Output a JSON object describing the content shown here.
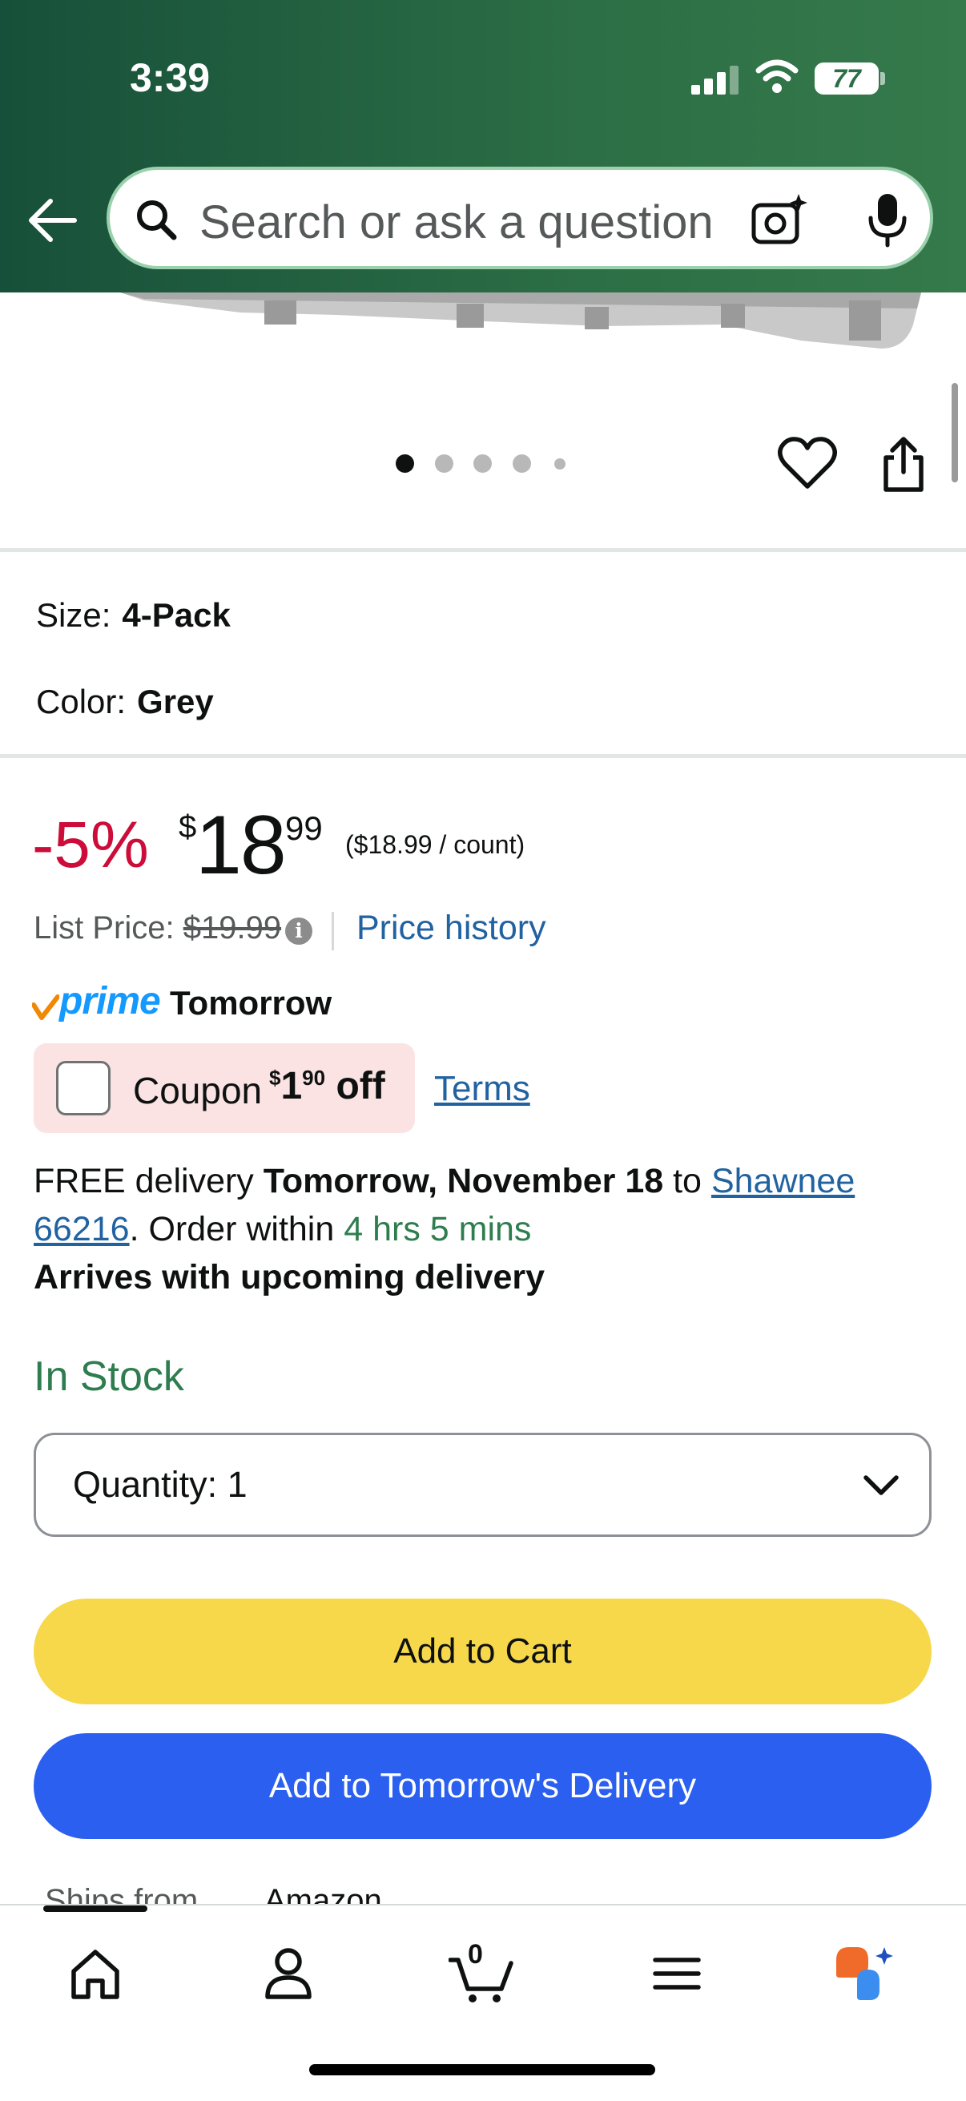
{
  "status_bar": {
    "time": "3:39",
    "battery": "77"
  },
  "search": {
    "placeholder": "Search or ask a question"
  },
  "gallery": {
    "dot_count": 5,
    "active_index": 0
  },
  "variants": {
    "size_label": "Size:",
    "size_value": "4-Pack",
    "color_label": "Color:",
    "color_value": "Grey"
  },
  "pricing": {
    "discount": "-5%",
    "currency": "$",
    "whole": "18",
    "fraction": "99",
    "unit_price": "($18.99 / count)",
    "list_label": "List Price:",
    "list_value": "$19.99",
    "info_glyph": "i",
    "history_link": "Price history"
  },
  "prime": {
    "brand": "prime",
    "speed": "Tomorrow"
  },
  "coupon": {
    "label": "Coupon",
    "currency": "$",
    "whole": "1",
    "fraction": "90",
    "off": "off",
    "terms": "Terms"
  },
  "delivery": {
    "prefix": "FREE delivery",
    "date": "Tomorrow, November 18",
    "to": "to",
    "location_line1": "Shawnee",
    "location_line2": "66216",
    "order_within": ". Order within",
    "countdown": "4 hrs 5 mins",
    "note": "Arrives with upcoming delivery"
  },
  "availability": "In Stock",
  "quantity": {
    "label": "Quantity:",
    "value": "1"
  },
  "buttons": {
    "add_to_cart": "Add to Cart",
    "add_to_delivery": "Add to Tomorrow's Delivery"
  },
  "ships": {
    "label": "Ships from",
    "value": "Amazon"
  },
  "bottom_nav": {
    "cart_count": "0"
  },
  "colors": {
    "header": "#2c6e45",
    "discount": "#cc0c39",
    "link": "#2162a1",
    "stock": "#2e7d4f",
    "cart_button": "#f6d84a",
    "delivery_button": "#2a5ff0"
  }
}
